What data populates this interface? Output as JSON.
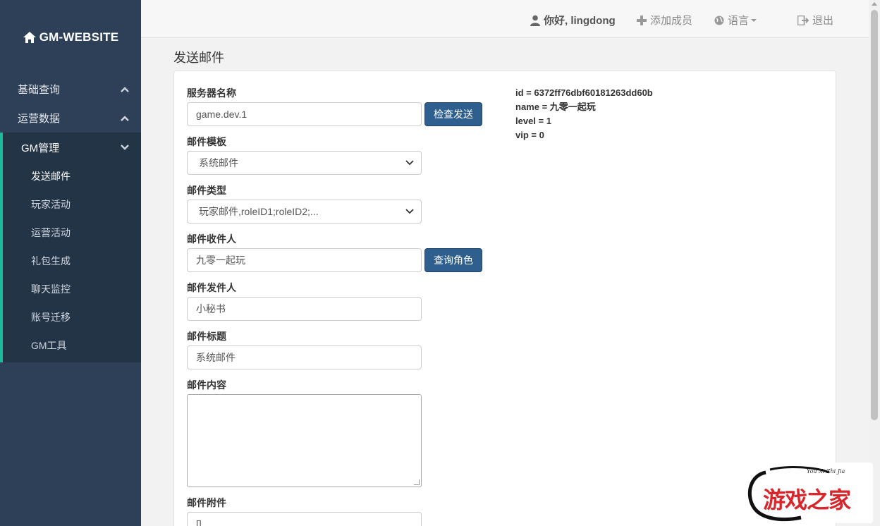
{
  "sidebar": {
    "brand": "GM-WEBSITE",
    "groups": [
      {
        "label": "基础查询"
      },
      {
        "label": "运营数据"
      },
      {
        "label": "GM管理"
      }
    ],
    "sub_items": [
      {
        "label": "发送邮件"
      },
      {
        "label": "玩家活动"
      },
      {
        "label": "运营活动"
      },
      {
        "label": "礼包生成"
      },
      {
        "label": "聊天监控"
      },
      {
        "label": "账号迁移"
      },
      {
        "label": "GM工具"
      }
    ]
  },
  "header": {
    "user": "你好, lingdong",
    "add_member": "添加成员",
    "language": "语言",
    "logout": "退出"
  },
  "page": {
    "title": "发送邮件"
  },
  "form": {
    "server_label": "服务器名称",
    "server_value": "game.dev.1",
    "check_send_button": "检查发送",
    "template_label": "邮件模板",
    "template_value": "系统邮件",
    "type_label": "邮件类型",
    "type_value": "玩家邮件,roleID1;roleID2;...",
    "recipient_label": "邮件收件人",
    "recipient_value": "九零一起玩",
    "query_role_button": "查询角色",
    "sender_label": "邮件发件人",
    "sender_value": "小秘书",
    "subject_label": "邮件标题",
    "subject_value": "系统邮件",
    "content_label": "邮件内容",
    "content_value": "",
    "attachment_label": "邮件附件",
    "attachment_value": "[]"
  },
  "role_info": [
    "id = 6372ff76dbf60181263dd60b",
    "name = 九零一起玩",
    "level = 1",
    "vip = 0"
  ],
  "watermark": {
    "script": "You Xi Zhi Jia",
    "text": "游戏之家"
  },
  "colors": {
    "sidebar": "#2e4057",
    "accent": "#1abc9c",
    "button": "#2f5f8f"
  }
}
